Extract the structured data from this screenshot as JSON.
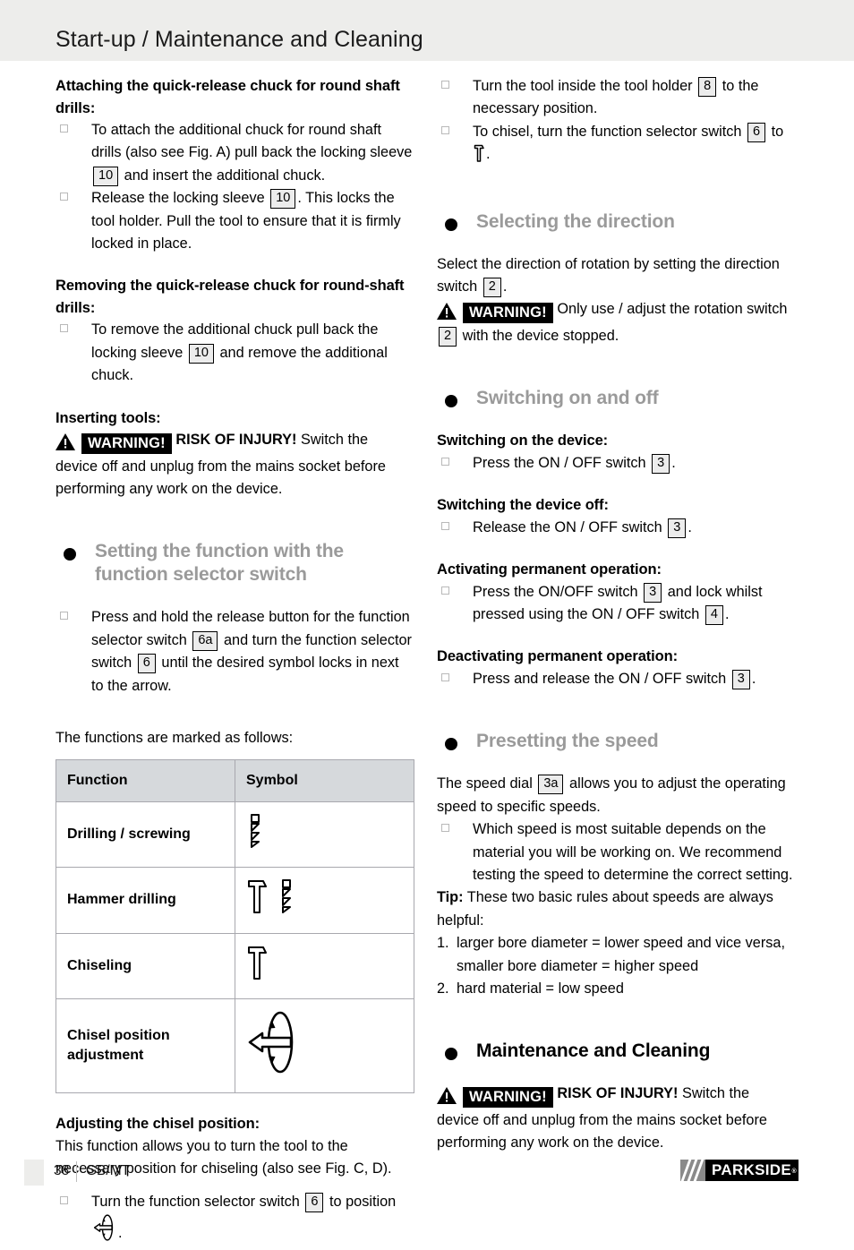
{
  "header": {
    "title": "Start-up / Maintenance and Cleaning"
  },
  "left": {
    "attach_heading": "Attaching the quick-release chuck for round shaft drills:",
    "attach_items": [
      {
        "a": "To attach the additional chuck for round shaft drills (also see Fig. A) pull back the locking sleeve",
        "ref": "10",
        "b": "and insert the additional chuck."
      },
      {
        "a": "Release the locking sleeve",
        "ref": "10",
        "b": ". This locks the tool holder. Pull the tool to ensure that it is firmly locked in place."
      }
    ],
    "remove_heading": "Removing the quick-release chuck for round-shaft drills:",
    "remove_items": [
      {
        "a": "To remove the additional chuck pull back the locking sleeve",
        "ref": "10",
        "b": "and remove the additional chuck."
      }
    ],
    "inserting_heading": "Inserting tools:",
    "warning_label": "WARNING!",
    "warning_strong": "RISK OF INJURY!",
    "warning_text": "Switch the device off and unplug from the mains socket before performing any work on the device.",
    "section_function": "Setting the function with the function selector switch",
    "function_item": {
      "a": "Press and hold the release button for the function selector switch",
      "ref1": "6a",
      "b": "and turn the function selector switch",
      "ref2": "6",
      "c": "until the desired symbol locks in next to the arrow."
    },
    "table_intro": "The functions are marked as follows:",
    "table": {
      "headers": [
        "Function",
        "Symbol"
      ],
      "rows": [
        {
          "function": "Drilling / screwing",
          "symbol": "drill-bit-icon"
        },
        {
          "function": "Hammer drilling",
          "symbol": "chisel-and-drill-bit-icon"
        },
        {
          "function": "Chiseling",
          "symbol": "chisel-icon"
        },
        {
          "function": "Chisel position adjustment",
          "symbol": "chisel-rotation-icon"
        }
      ]
    },
    "chisel_heading": "Adjusting the chisel position:",
    "chisel_text": "This function allows you to turn the tool to the necessary position for chiseling (also see Fig. C, D).",
    "chisel_item": {
      "a": "Turn the function selector switch",
      "ref": "6",
      "b": "to position",
      "c": "."
    }
  },
  "right": {
    "top_items": [
      {
        "a": "Turn the tool inside the tool holder",
        "ref": "8",
        "b": "to the necessary position."
      },
      {
        "a": "To chisel, turn the function selector switch",
        "ref": "6",
        "b": "to",
        "c": "."
      }
    ],
    "section_direction": "Selecting the direction",
    "direction_text_a": "Select the direction of rotation by setting the direction switch",
    "direction_ref": "2",
    "direction_text_b": ".",
    "warning_label": "WARNING!",
    "direction_warning_a": "Only use / adjust the rotation switch",
    "direction_warning_ref": "2",
    "direction_warning_b": "with the device stopped.",
    "section_switching": "Switching on and off",
    "switch_on_heading": "Switching on the device:",
    "switch_on_item": {
      "a": "Press the ON / OFF switch",
      "ref": "3",
      "b": "."
    },
    "switch_off_heading": "Switching the device off:",
    "switch_off_item": {
      "a": "Release the ON / OFF switch",
      "ref": "3",
      "b": "."
    },
    "permanent_on_heading": "Activating permanent operation:",
    "permanent_on_item": {
      "a": "Press the ON/OFF switch",
      "ref1": "3",
      "b": "and lock whilst pressed using the ON / OFF switch",
      "ref2": "4",
      "c": "."
    },
    "permanent_off_heading": "Deactivating permanent operation:",
    "permanent_off_item": {
      "a": "Press and release the ON / OFF switch",
      "ref": "3",
      "b": "."
    },
    "section_speed": "Presetting the speed",
    "speed_text_a": "The speed dial",
    "speed_ref": "3a",
    "speed_text_b": "allows you to adjust the operating speed to specific speeds.",
    "speed_item": "Which speed is most suitable depends on the material you will be working on. We recommend testing the speed to determine the correct setting.",
    "tip_label": "Tip:",
    "tip_text": "These two basic rules about speeds are always helpful:",
    "tip_rules": [
      {
        "num": "1.",
        "text": "larger bore diameter = lower speed and vice versa, smaller bore diameter = higher speed"
      },
      {
        "num": "2.",
        "text": "hard material = low speed"
      }
    ],
    "section_maintenance": "Maintenance and Cleaning",
    "maint_warning_label": "WARNING!",
    "maint_warning_strong": "RISK OF INJURY!",
    "maint_warning_text": "Switch the device off and unplug from the mains socket before performing any work on the device."
  },
  "footer": {
    "page": "38",
    "language": "GB/MT",
    "brand": "PARKSIDE",
    "registered": "®"
  }
}
